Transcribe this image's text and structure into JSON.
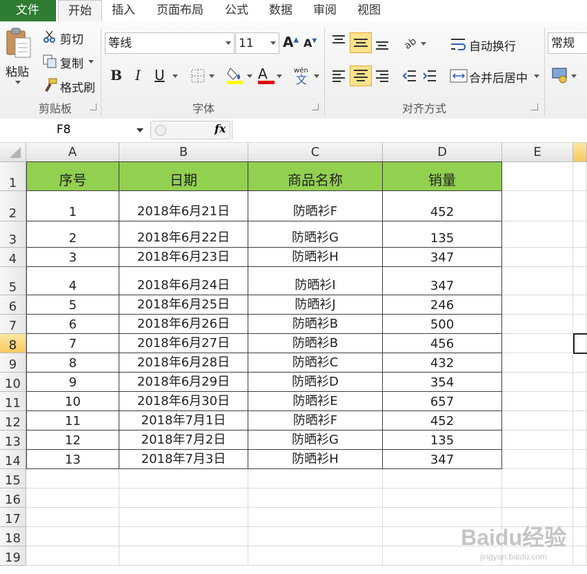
{
  "tabs": [
    "文件",
    "开始",
    "插入",
    "页面布局",
    "公式",
    "数据",
    "审阅",
    "视图"
  ],
  "clipboard": {
    "paste": "粘贴",
    "cut": "剪切",
    "copy": "复制",
    "format_painter": "格式刷",
    "label": "剪贴板"
  },
  "font": {
    "name": "等线",
    "size": "11",
    "label": "字体",
    "bold": "B",
    "italic": "I",
    "underline": "U",
    "color_letter": "A"
  },
  "alignment": {
    "wrap": "自动换行",
    "merge": "合并后居中",
    "label": "对齐方式"
  },
  "number": {
    "format": "常规"
  },
  "name_box": "F8",
  "fx": "fx",
  "columns": [
    "A",
    "B",
    "C",
    "D",
    "E"
  ],
  "rows": [
    "1",
    "2",
    "3",
    "4",
    "5",
    "6",
    "7",
    "8",
    "9",
    "10",
    "11",
    "12",
    "13",
    "14",
    "15",
    "16",
    "17",
    "18",
    "19"
  ],
  "table": {
    "headers": [
      "序号",
      "日期",
      "商品名称",
      "销量"
    ],
    "rows": [
      [
        "1",
        "2018年6月21日",
        "防晒衫F",
        "452"
      ],
      [
        "2",
        "2018年6月22日",
        "防晒衫G",
        "135"
      ],
      [
        "3",
        "2018年6月23日",
        "防晒衫H",
        "347"
      ],
      [
        "4",
        "2018年6月24日",
        "防晒衫I",
        "347"
      ],
      [
        "5",
        "2018年6月25日",
        "防晒衫J",
        "246"
      ],
      [
        "6",
        "2018年6月26日",
        "防晒衫B",
        "500"
      ],
      [
        "7",
        "2018年6月27日",
        "防晒衫B",
        "456"
      ],
      [
        "8",
        "2018年6月28日",
        "防晒衫C",
        "432"
      ],
      [
        "9",
        "2018年6月29日",
        "防晒衫D",
        "354"
      ],
      [
        "10",
        "2018年6月30日",
        "防晒衫E",
        "657"
      ],
      [
        "11",
        "2018年7月1日",
        "防晒衫F",
        "452"
      ],
      [
        "12",
        "2018年7月2日",
        "防晒衫G",
        "135"
      ],
      [
        "13",
        "2018年7月3日",
        "防晒衫H",
        "347"
      ]
    ]
  },
  "colors": {
    "header_fill": "#92d050",
    "file_tab": "#2e7d32",
    "highlight": "#fce38a"
  },
  "watermark": {
    "main": "Baidu经验",
    "sub": "jingyan.baidu.com"
  }
}
